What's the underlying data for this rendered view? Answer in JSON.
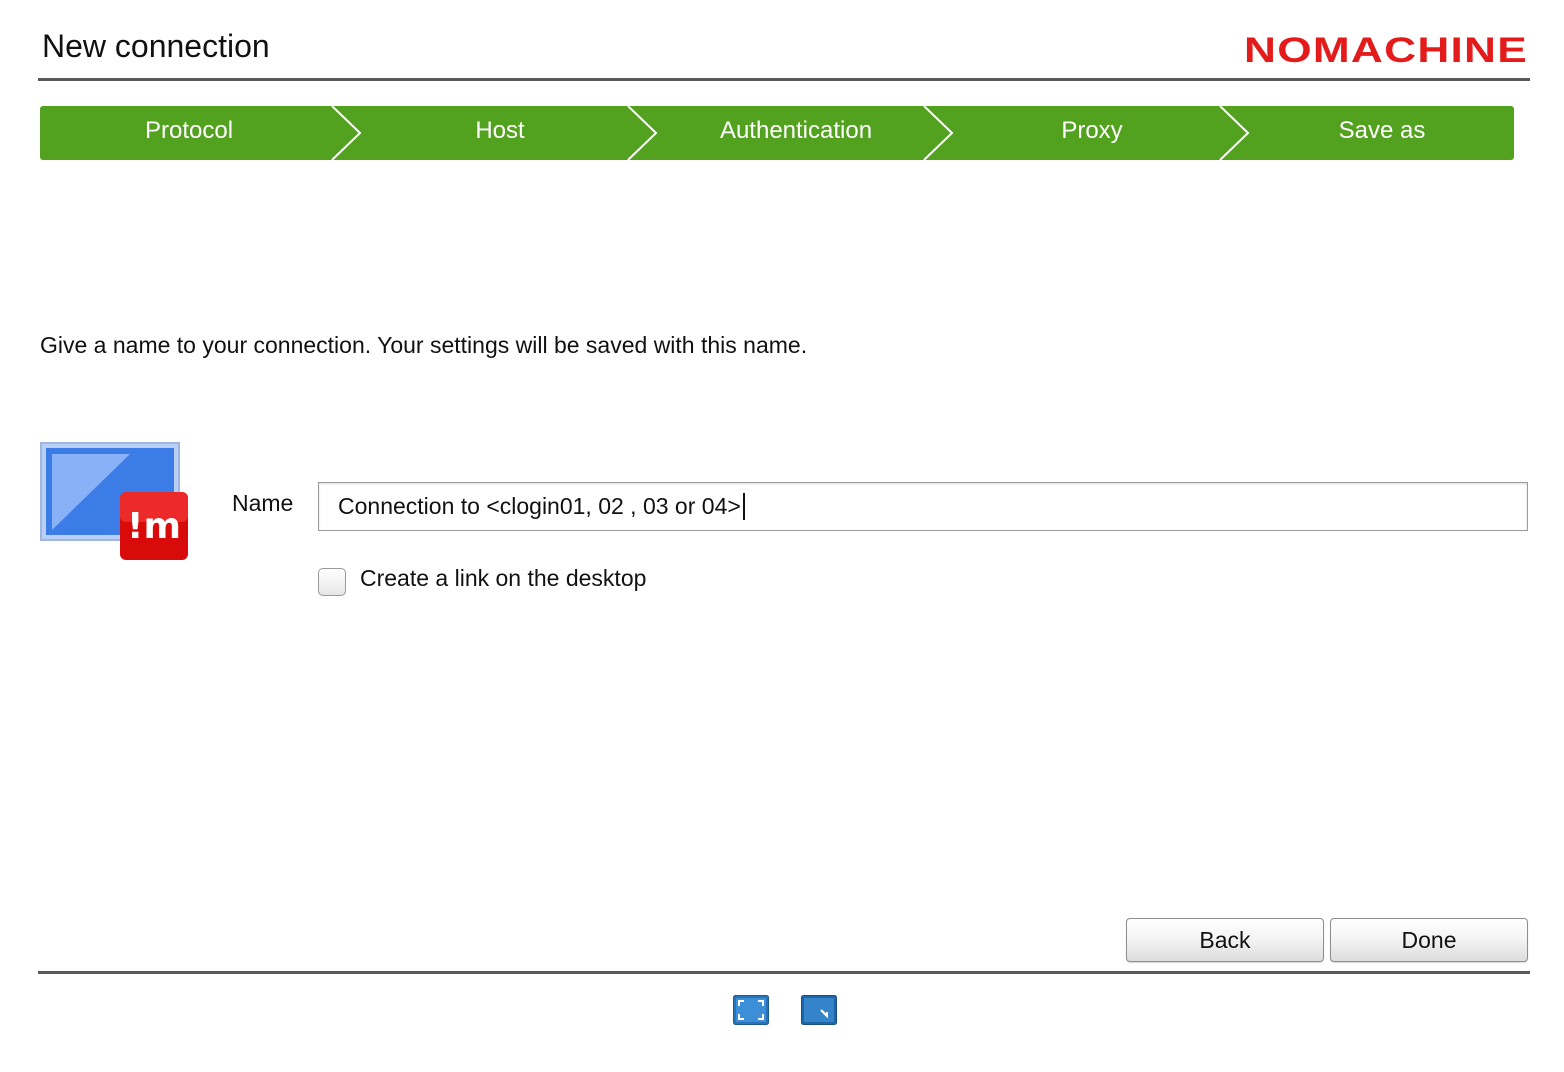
{
  "header": {
    "title": "New connection",
    "logo_text": "NOMACHINE"
  },
  "wizard": {
    "steps": [
      {
        "label": "Protocol"
      },
      {
        "label": "Host"
      },
      {
        "label": "Authentication"
      },
      {
        "label": "Proxy"
      },
      {
        "label": "Save as"
      }
    ],
    "active_step": "Save as"
  },
  "main": {
    "instruction": "Give a name to your connection. Your settings will be saved with this name.",
    "name_label": "Name",
    "name_value": "Connection to <clogin01, 02 , 03 or 04>",
    "desktop_link_label": "Create a link on the desktop",
    "desktop_link_checked": false
  },
  "footer": {
    "back_label": "Back",
    "done_label": "Done",
    "view_icons": [
      "fullscreen-icon",
      "fit-to-window-icon"
    ]
  },
  "colors": {
    "step_bar": "#52a21f",
    "logo_red": "#e31b1b",
    "icon_blue": "#3b7ce6",
    "rule": "#5a5a5a"
  }
}
